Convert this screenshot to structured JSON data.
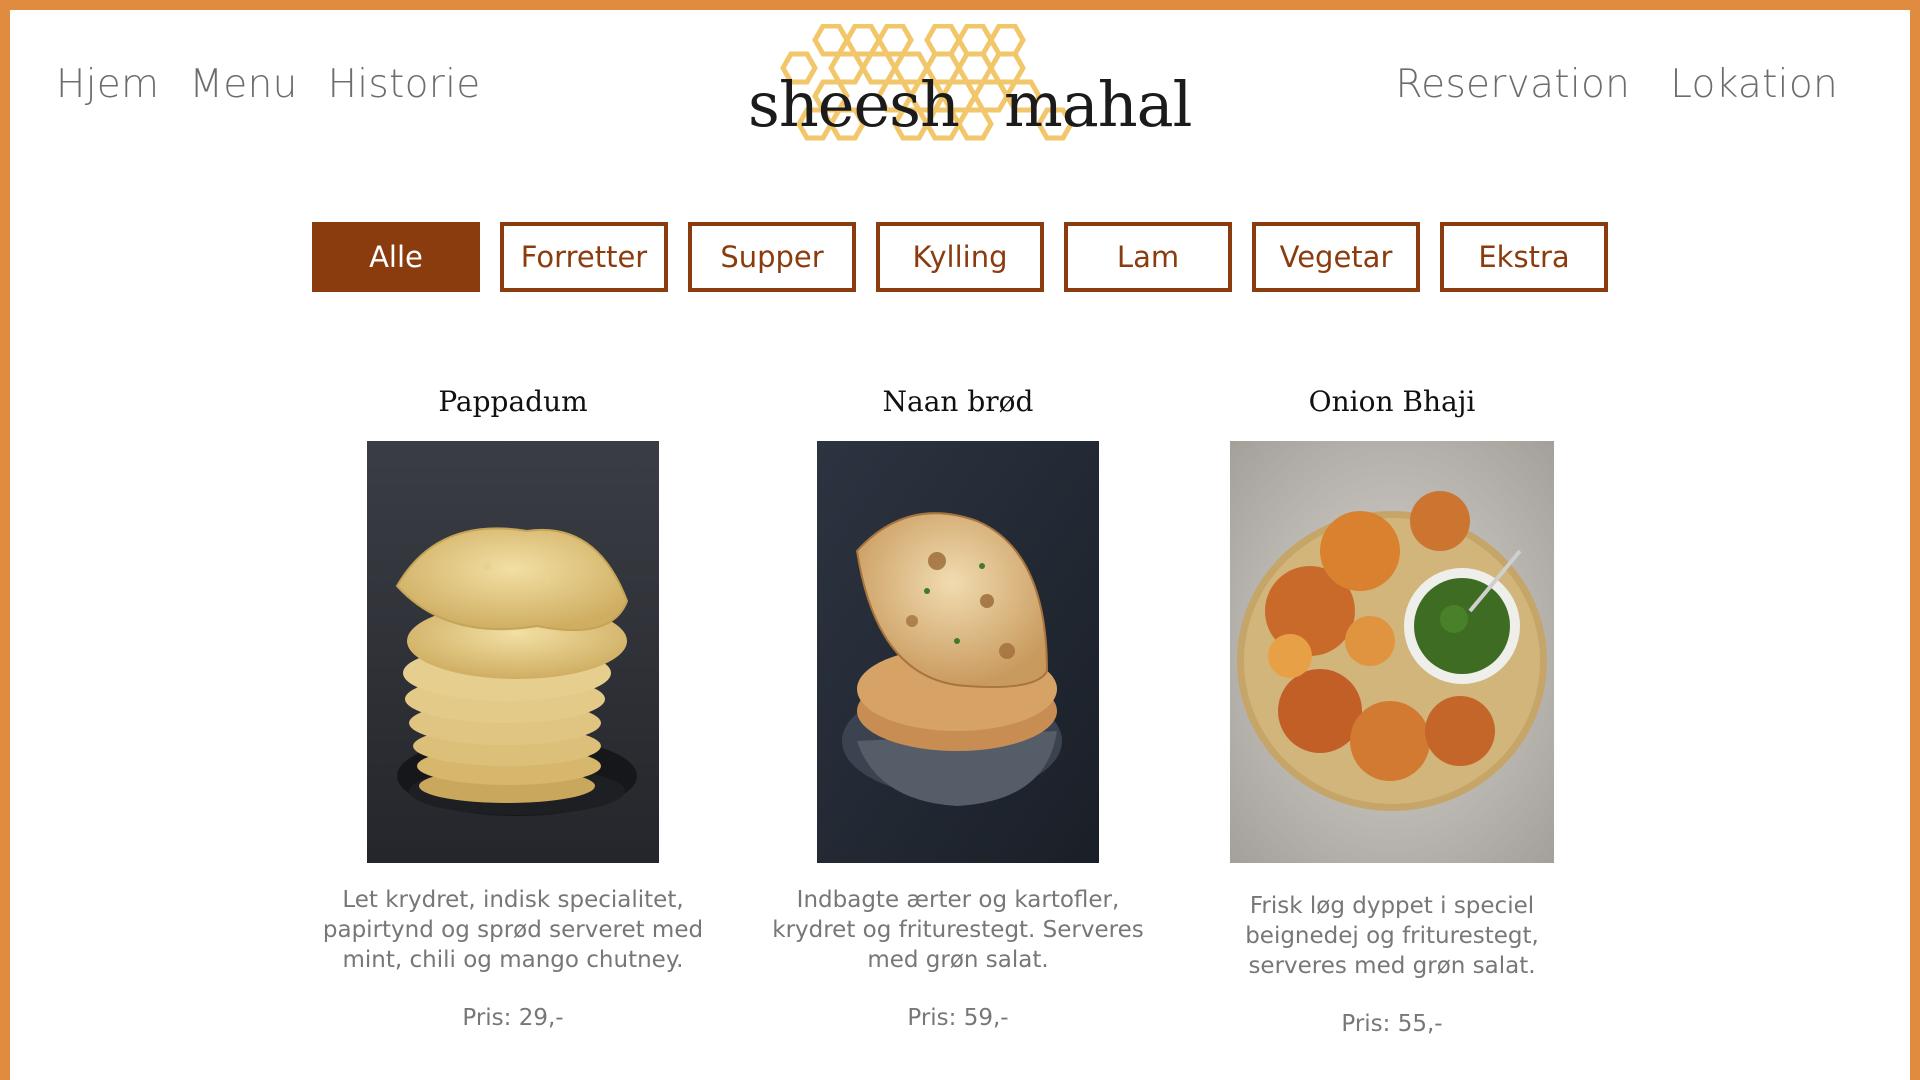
{
  "nav": {
    "left": [
      "Hjem",
      "Menu",
      "Historie"
    ],
    "right": [
      "Reservation",
      "Lokation"
    ]
  },
  "logo": {
    "word1": "sheesh",
    "word2": "mahal",
    "honeycomb_color": "#f2c76b"
  },
  "colors": {
    "frame": "#df8c3f",
    "accent": "#8b3c0f"
  },
  "filters": {
    "items": [
      "Alle",
      "Forretter",
      "Supper",
      "Kylling",
      "Lam",
      "Vegetar",
      "Ekstra"
    ],
    "active": "Alle"
  },
  "menu": {
    "items": [
      {
        "name": "Pappadum",
        "description": "Let krydret, indisk specialitet, papirtynd og sprød serveret med mint, chili og mango chutney.",
        "price": "Pris: 29,-",
        "image": "pappadum-stack-photo"
      },
      {
        "name": "Naan brød",
        "description": "Indbagte ærter og kartofler, krydret og friturestegt. Serveres med grøn salat.",
        "price": "Pris: 59,-",
        "image": "naan-bread-basket-photo"
      },
      {
        "name": "Onion Bhaji",
        "description": "Frisk løg dyppet i speciel beignedej og friturestegt, serveres med grøn salat.",
        "price": "Pris: 55,-",
        "image": "onion-bhaji-platter-photo"
      }
    ]
  }
}
